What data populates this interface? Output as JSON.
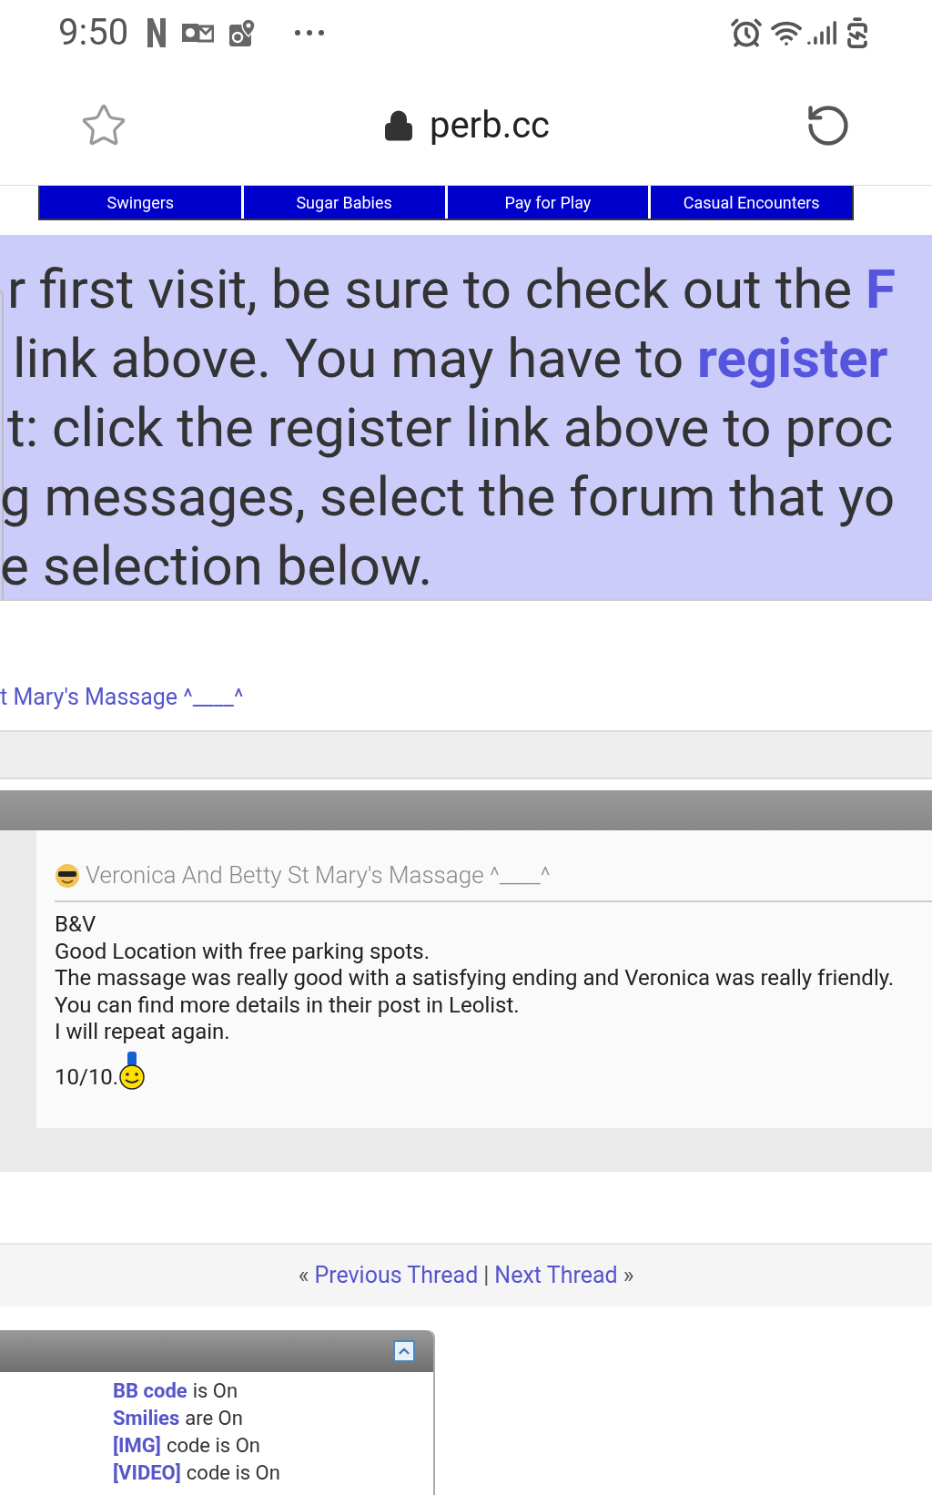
{
  "status_bar": {
    "time": "9:50"
  },
  "browser": {
    "url": "perb.cc"
  },
  "nav_tabs": [
    "Swingers",
    "Sugar Babies",
    "Pay for Play",
    "Casual Encounters"
  ],
  "notice": {
    "lines": [
      [
        {
          "kind": "text",
          "text": "r first visit, be sure to check out the "
        },
        {
          "kind": "link",
          "text": "F"
        }
      ],
      [
        {
          "kind": "text",
          "text": "link above. You may have to "
        },
        {
          "kind": "link",
          "text": "register"
        }
      ],
      [
        {
          "kind": "text",
          "text": "t: click the register link above to proc"
        }
      ],
      [
        {
          "kind": "text",
          "text": "g messages, select the forum that yo"
        }
      ],
      [
        {
          "kind": "text",
          "text": "e selection below."
        }
      ]
    ]
  },
  "breadcrumb": "t Mary's Massage ^____^",
  "post": {
    "title": "Veronica And Betty St Mary's Massage ^____^",
    "lines": [
      "B&V",
      "Good Location with free parking spots.",
      "The massage was really good with a satisfying ending and Veronica was really friendly.",
      "You can find more details in their post in Leolist.",
      "I will repeat again."
    ],
    "rating": "10/10."
  },
  "thread_nav": {
    "prefix": "«",
    "previous": "Previous Thread",
    "separator": "|",
    "next": "Next Thread",
    "suffix": "»"
  },
  "rules": [
    {
      "link": "BB code",
      "rest": "is On"
    },
    {
      "link": "Smilies",
      "rest": "are On"
    },
    {
      "link": "[IMG]",
      "rest": "code is On"
    },
    {
      "link": "[VIDEO]",
      "rest": "code is On"
    }
  ]
}
